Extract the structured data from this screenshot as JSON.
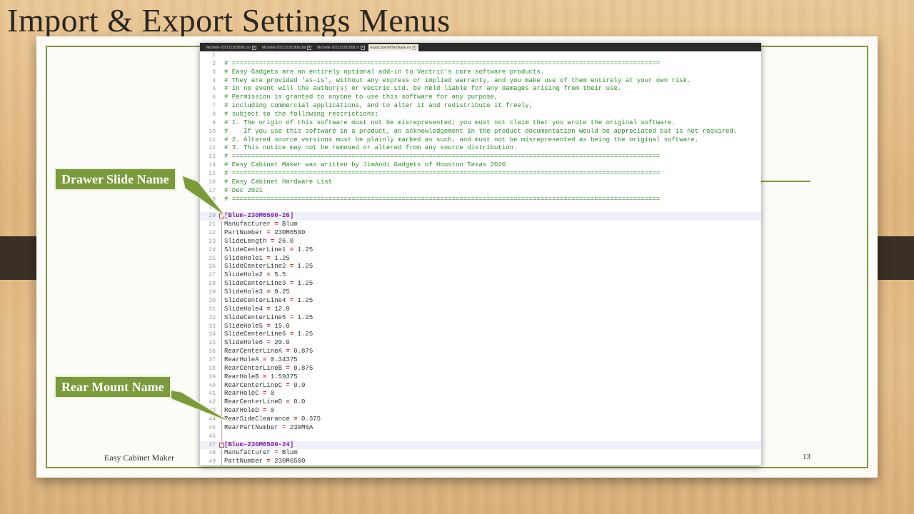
{
  "slide": {
    "title": "Import & Export Settings Menus",
    "footer_left": "Easy Cabinet Maker",
    "page_number": "13"
  },
  "callouts": {
    "drawer_slide": "Drawer Slide Name",
    "rear_mount": "Rear Mount Name"
  },
  "editor": {
    "tabs": [
      {
        "label": "Michelle-20211220180​8.csv",
        "active": false
      },
      {
        "label": "Michelle-20211220180​8.dat",
        "active": false
      },
      {
        "label": "Michelle-202112201808.xt",
        "active": false
      },
      {
        "label": "EasyCabinetHardware.ini",
        "active": true
      }
    ],
    "lines": [
      {
        "n": "1",
        "t": "",
        "c": "comment"
      },
      {
        "n": "2",
        "t": "# ===============================================================================================================",
        "c": "comment"
      },
      {
        "n": "3",
        "t": "# Easy Gadgets are an entirely optional add-in to Vectric's core software products.",
        "c": "comment"
      },
      {
        "n": "4",
        "t": "# They are provided 'as-is', without any express or implied warranty, and you make use of them entirely at your own risk.",
        "c": "comment"
      },
      {
        "n": "5",
        "t": "# In no event will the author(s) or Vectric Ltd. be held liable for any damages arising from their use.",
        "c": "comment"
      },
      {
        "n": "6",
        "t": "# Permission is granted to anyone to use this software for any purpose,",
        "c": "comment"
      },
      {
        "n": "7",
        "t": "# including commercial applications, and to alter it and redistribute it freely,",
        "c": "comment"
      },
      {
        "n": "8",
        "t": "# subject to the following restrictions:",
        "c": "comment"
      },
      {
        "n": "9",
        "t": "# 1. The origin of this software must not be misrepresented; you must not claim that you wrote the original software.",
        "c": "comment"
      },
      {
        "n": "10",
        "t": "#    If you use this software in a product, an acknowledgement in the product documentation would be appreciated but is not required.",
        "c": "comment"
      },
      {
        "n": "11",
        "t": "# 2. Altered source versions must be plainly marked as such, and must not be misrepresented as being the original software.",
        "c": "comment"
      },
      {
        "n": "12",
        "t": "# 3. This notice may not be removed or altered from any source distribution.",
        "c": "comment"
      },
      {
        "n": "13",
        "t": "# ===============================================================================================================",
        "c": "comment"
      },
      {
        "n": "14",
        "t": "# Easy Cabinet Maker was written by JimAndi Gadgets of Houston Texas 2020",
        "c": "comment"
      },
      {
        "n": "15",
        "t": "# ===============================================================================================================",
        "c": "comment"
      },
      {
        "n": "16",
        "t": "# Easy Cabinet Hardware List",
        "c": "comment"
      },
      {
        "n": "17",
        "t": "# Dec 2021",
        "c": "comment"
      },
      {
        "n": "18",
        "t": "# ===============================================================================================================",
        "c": "comment"
      },
      {
        "n": "19",
        "t": "",
        "c": "comment"
      },
      {
        "n": "20",
        "t": "[Blum-230M6500-26]",
        "c": "section"
      },
      {
        "n": "21",
        "k": "Manufacturer",
        "v": "Blum",
        "c": "kv"
      },
      {
        "n": "22",
        "k": "PartNumber",
        "v": "230M6500",
        "c": "kv"
      },
      {
        "n": "23",
        "k": "SlideLength",
        "v": "26.0",
        "c": "kv"
      },
      {
        "n": "24",
        "k": "SlideCenterLine1",
        "v": "1.25",
        "c": "kv"
      },
      {
        "n": "25",
        "k": "SlideHole1",
        "v": "1.25",
        "c": "kv"
      },
      {
        "n": "26",
        "k": "SlideCenterLine2",
        "v": "1.25",
        "c": "kv"
      },
      {
        "n": "27",
        "k": "SlideHole2",
        "v": "5.5",
        "c": "kv"
      },
      {
        "n": "28",
        "k": "SlideCenterLine3",
        "v": "1.25",
        "c": "kv"
      },
      {
        "n": "29",
        "k": "SlideHole3",
        "v": "9.25",
        "c": "kv"
      },
      {
        "n": "30",
        "k": "SlideCenterLine4",
        "v": "1.25",
        "c": "kv"
      },
      {
        "n": "31",
        "k": "SlideHole4",
        "v": "12.0",
        "c": "kv"
      },
      {
        "n": "32",
        "k": "SlideCenterLine5",
        "v": "1.25",
        "c": "kv"
      },
      {
        "n": "33",
        "k": "SlideHole5",
        "v": "15.0",
        "c": "kv"
      },
      {
        "n": "34",
        "k": "SlideCenterLine6",
        "v": "1.25",
        "c": "kv"
      },
      {
        "n": "35",
        "k": "SlideHole6",
        "v": "20.0",
        "c": "kv"
      },
      {
        "n": "36",
        "k": "RearCenterLineA",
        "v": "0.875",
        "c": "kv"
      },
      {
        "n": "37",
        "k": "RearHoleA",
        "v": "0.34375",
        "c": "kv"
      },
      {
        "n": "38",
        "k": "RearCenterLineB",
        "v": "0.875",
        "c": "kv"
      },
      {
        "n": "39",
        "k": "RearHoleB",
        "v": "1.59375",
        "c": "kv"
      },
      {
        "n": "40",
        "k": "RearCenterLineC",
        "v": "0.0",
        "c": "kv"
      },
      {
        "n": "41",
        "k": "RearHoleC",
        "v": "0",
        "c": "kv"
      },
      {
        "n": "42",
        "k": "RearCenterLineD",
        "v": "0.0",
        "c": "kv"
      },
      {
        "n": "43",
        "k": "RearHoleD",
        "v": "0",
        "c": "kv"
      },
      {
        "n": "44",
        "k": "RearSideClearance",
        "v": "0.375",
        "c": "kv"
      },
      {
        "n": "45",
        "k": "RearPartNumber",
        "v": "230M6A",
        "c": "kv"
      },
      {
        "n": "46",
        "t": "",
        "c": "comment"
      },
      {
        "n": "47",
        "t": "[Blum-230M6500-24]",
        "c": "section"
      },
      {
        "n": "48",
        "k": "Manufacturer",
        "v": "Blum",
        "c": "kv"
      },
      {
        "n": "49",
        "k": "PartNumber",
        "v": "230M6500",
        "c": "kv"
      }
    ]
  },
  "colors": {
    "accent_green": "#7a9a3b",
    "comment": "#2e8b2e",
    "section": "#7b20a8",
    "operator": "#e02020"
  }
}
